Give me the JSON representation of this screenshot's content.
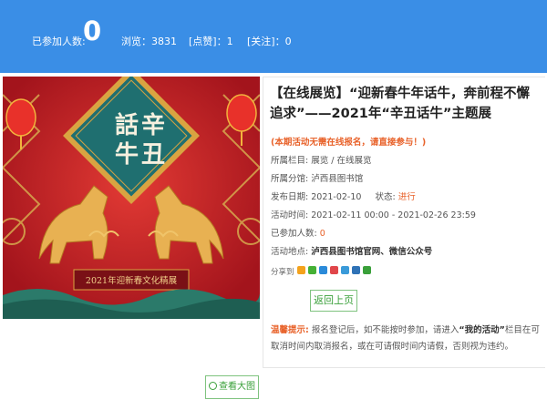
{
  "header": {
    "participants_label": "已参加人数:",
    "participants_value": "0",
    "views": "浏览：3831",
    "likes": "[点赞]：1",
    "follows": "[关注]：0"
  },
  "poster": {
    "diamond_text": [
      "話",
      "辛",
      "牛",
      "丑"
    ],
    "banner_text": "2021年迎新春文化精展"
  },
  "activity": {
    "title": "【在线展览】“迎新春牛年话牛，奔前程不懈追求”——2021年“辛丑话牛”主题展",
    "notice": "(本期活动无需在线报名，请直接参与！)",
    "column_label": "所属栏目:",
    "column_value": "展览 / 在线展览",
    "branch_label": "所属分馆:",
    "branch_value": "泸西县图书馆",
    "publish_label": "发布日期:",
    "publish_value": "2021-02-10",
    "status_label": "状态:",
    "status_value": "进行",
    "time_label": "活动时间:",
    "time_value": "2021-02-11 00:00 - 2021-02-26 23:59",
    "joined_label": "已参加人数:",
    "joined_value": "0",
    "place_label": "活动地点:",
    "place_value": "泸西县图书馆官网、微信公众号",
    "share_label": "分享到",
    "share_icons": [
      "qzone-icon",
      "wechat-icon",
      "qq-icon",
      "weibo-icon",
      "tencent-weibo-icon",
      "renren-icon",
      "douban-icon"
    ],
    "share_colors": [
      "#f4a21c",
      "#45b035",
      "#2a8ad9",
      "#e0464a",
      "#3a9ad9",
      "#2f72b6",
      "#3aa03a"
    ],
    "back_label": "返回上页"
  },
  "tip": {
    "label": "温馨提示:",
    "text_1": "报名登记后，如不能按时参加，请进入",
    "highlight": "“我的活动”",
    "text_2": "栏目在可取消时间内取消报名，或在可请假时间内请假，否则视为违约。"
  },
  "view_large_label": "查看大图"
}
